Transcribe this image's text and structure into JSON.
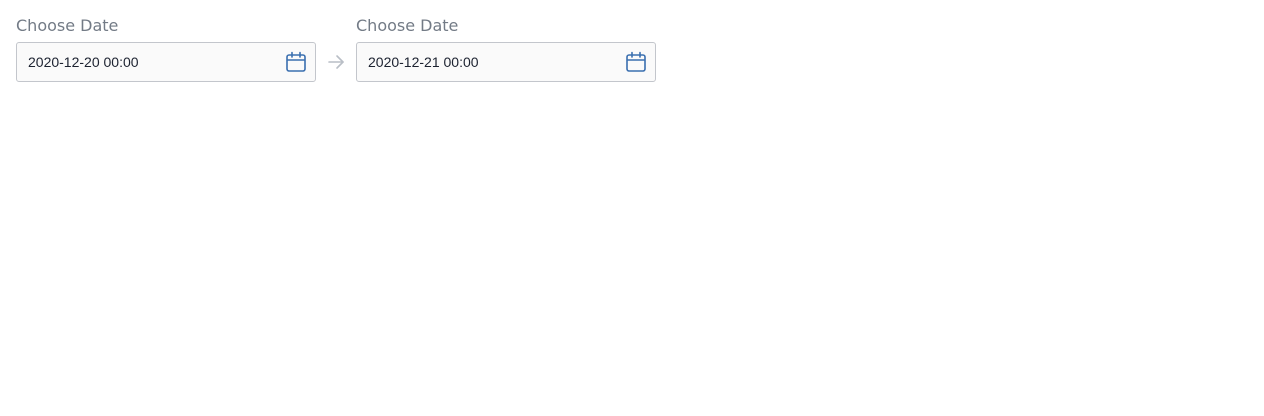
{
  "range": {
    "start": {
      "label": "Choose Date",
      "value": "2020-12-20 00:00",
      "icon": "calendar-icon"
    },
    "end": {
      "label": "Choose Date",
      "value": "2020-12-21 00:00",
      "icon": "calendar-icon"
    },
    "separator_icon": "arrow-right-icon"
  },
  "colors": {
    "label": "#737b86",
    "input_border": "#c3c6cc",
    "input_bg": "#fafafa",
    "icon_accent": "#3a6fb0",
    "arrow": "#b9bec6"
  }
}
